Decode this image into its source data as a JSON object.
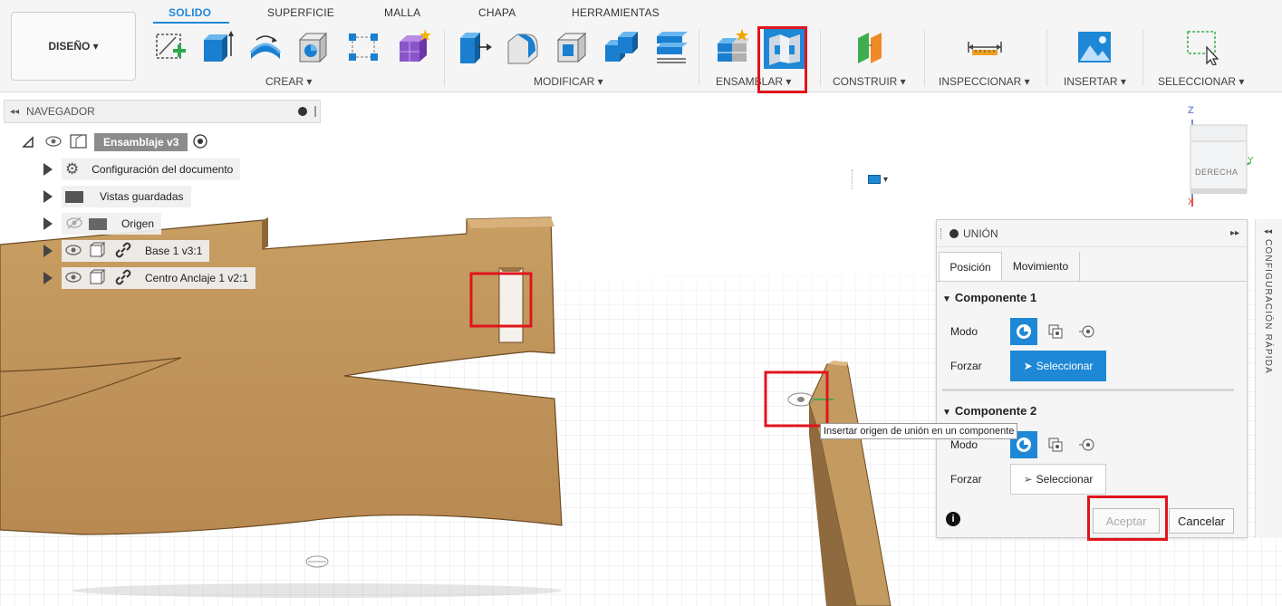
{
  "toolbar": {
    "design_label": "DISEÑO ▾",
    "tabs": [
      "SOLIDO",
      "SUPERFICIE",
      "MALLA",
      "CHAPA",
      "HERRAMIENTAS"
    ],
    "groups": {
      "create": "CREAR ▾",
      "modify": "MODIFICAR ▾",
      "assemble": "ENSAMBLAR ▾",
      "construct": "CONSTRUIR ▾",
      "inspect": "INSPECCIONAR ▾",
      "insert": "INSERTAR ▾",
      "select": "SELECCIONAR ▾"
    },
    "icons": {
      "create": [
        "create-sketch-icon",
        "extrude-icon",
        "revolve-icon",
        "hole-icon",
        "pattern-icon",
        "create-form-icon"
      ],
      "modify": [
        "press-pull-icon",
        "fillet-icon",
        "shell-icon",
        "combine-icon",
        "align-icon"
      ],
      "assemble": [
        "new-component-icon",
        "joint-icon"
      ],
      "construct": "offset-plane-icon",
      "inspect": "measure-icon",
      "insert": "insert-image-icon",
      "select": "window-select-icon"
    },
    "accent_color": "#1e88d6"
  },
  "navigator": {
    "title": "NAVEGADOR",
    "root": "Ensamblaje v3",
    "items": [
      {
        "label": "Configuración del documento",
        "icon": "gear-icon"
      },
      {
        "label": "Vistas guardadas",
        "icon": "folder-icon"
      },
      {
        "label": "Origen",
        "icon": "folder-icon"
      },
      {
        "label": "Base 1 v3:1",
        "icon": "component-icon"
      },
      {
        "label": "Centro Anclaje 1 v2:1",
        "icon": "component-icon"
      }
    ]
  },
  "viewcube": {
    "face": "DERECHA",
    "axis_z": "Z",
    "axis_x": "X",
    "axis_y": "Y"
  },
  "display_settings": "▾",
  "union_panel": {
    "title": "UNIÓN",
    "tabs": [
      "Posición",
      "Movimiento"
    ],
    "component1": {
      "header": "Componente 1",
      "mode_label": "Modo",
      "force_label": "Forzar",
      "select_label": "Seleccionar"
    },
    "component2": {
      "header": "Componente 2",
      "mode_label": "Modo",
      "force_label": "Forzar",
      "select_label": "Seleccionar"
    },
    "accept": "Aceptar",
    "cancel": "Cancelar",
    "info": "i"
  },
  "quick_config": "CONFIGURACIÓN RÁPIDA",
  "tooltip": "Insertar origen de unión en un componente"
}
